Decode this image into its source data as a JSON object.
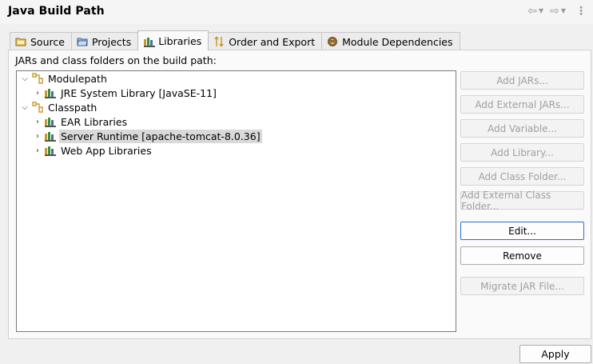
{
  "window": {
    "title": "Java Build Path"
  },
  "nav": {
    "back": "⇦",
    "forward": "⇨",
    "dropdown": "▼",
    "more": "⋮"
  },
  "tabs": [
    {
      "label": "Source",
      "icon": "source-folder-icon",
      "active": false
    },
    {
      "label": "Projects",
      "icon": "projects-folder-icon",
      "active": false
    },
    {
      "label": "Libraries",
      "icon": "libraries-icon",
      "active": true
    },
    {
      "label": "Order and Export",
      "icon": "order-export-icon",
      "active": false
    },
    {
      "label": "Module Dependencies",
      "icon": "module-icon",
      "active": false
    }
  ],
  "panel": {
    "label": "JARs and class folders on the build path:"
  },
  "tree": [
    {
      "label": "Modulepath",
      "expanded": true,
      "level": 0,
      "icon": "path-icon",
      "selected": false
    },
    {
      "label": "JRE System Library [JavaSE-11]",
      "expanded": false,
      "level": 1,
      "icon": "library-icon",
      "selected": false
    },
    {
      "label": "Classpath",
      "expanded": true,
      "level": 0,
      "icon": "path-icon",
      "selected": false
    },
    {
      "label": "EAR Libraries",
      "expanded": false,
      "level": 1,
      "icon": "library-icon",
      "selected": false
    },
    {
      "label": "Server Runtime [apache-tomcat-8.0.36]",
      "expanded": false,
      "level": 1,
      "icon": "library-icon",
      "selected": true
    },
    {
      "label": "Web App Libraries",
      "expanded": false,
      "level": 1,
      "icon": "library-icon",
      "selected": false
    }
  ],
  "buttons": {
    "add_jars": "Add JARs...",
    "add_external_jars": "Add External JARs...",
    "add_variable": "Add Variable...",
    "add_library": "Add Library...",
    "add_class_folder": "Add Class Folder...",
    "add_external_class_folder": "Add External Class Folder...",
    "edit": "Edit...",
    "remove": "Remove",
    "migrate_jar": "Migrate JAR File..."
  },
  "footer": {
    "apply": "Apply"
  }
}
